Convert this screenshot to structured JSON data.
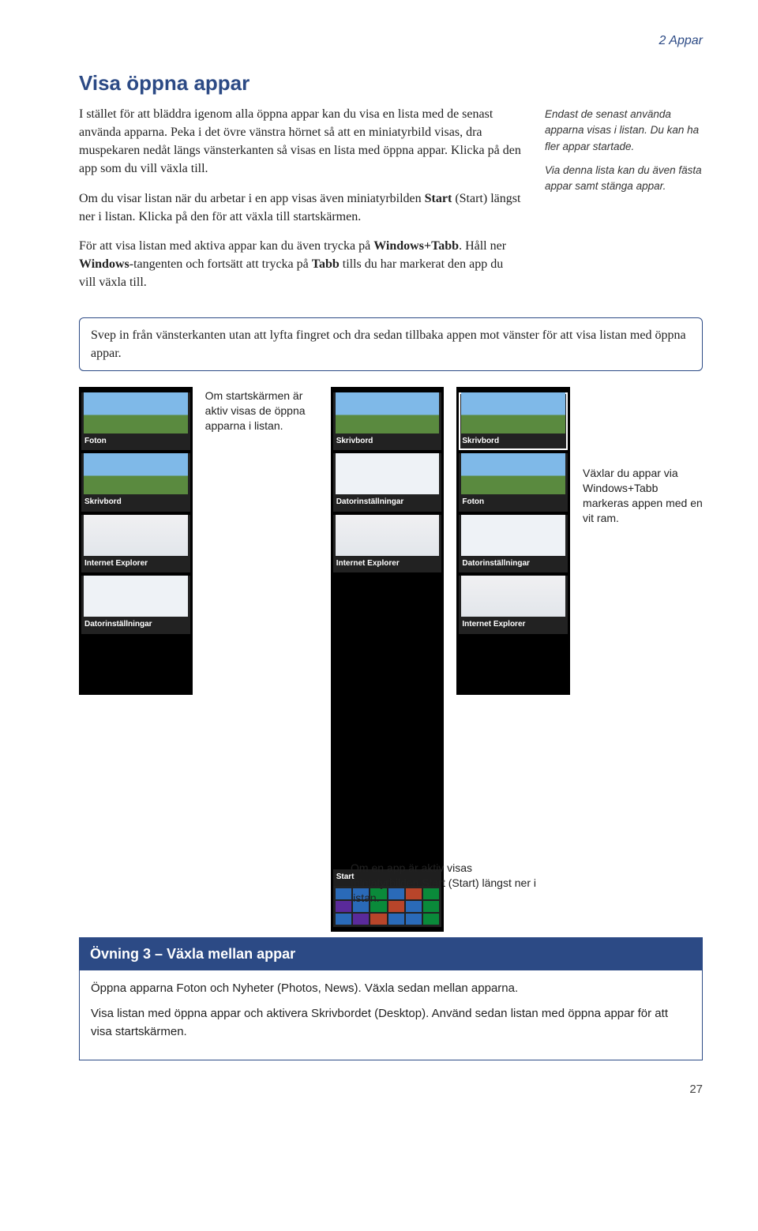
{
  "chapter_label": "2 Appar",
  "heading": "Visa öppna appar",
  "para1": "I stället för att bläddra igenom alla öppna appar kan du visa en lista med de senast använda apparna. Peka i det övre vänstra hörnet så att en miniatyrbild visas, dra muspekaren nedåt längs vänsterkanten så visas en lista med öppna appar. Klicka på den app som du vill växla till.",
  "para2_before": "Om du visar listan när du arbetar i en app visas även miniatyrbilden ",
  "para2_bold1": "Start",
  "para2_mid": " (Start) längst ner i listan. Klicka på den för att växla till startskärmen.",
  "para3_before": "För att visa listan med aktiva appar kan du även trycka på ",
  "para3_bold1": "Windows+Tabb",
  "para3_mid": ". Håll ner ",
  "para3_bold2": "Windows",
  "para3_mid2": "-tangenten och fortsätt att trycka på ",
  "para3_bold3": "Tabb",
  "para3_end": " tills du har markerat den app du vill växla till.",
  "sidenote1": "Endast de senast använda apparna visas i listan. Du kan ha fler appar startade.",
  "sidenote2": "Via denna lista kan du även fästa appar samt stänga appar.",
  "tipbox": "Svep in från vänsterkanten utan att lyfta fingret och dra sedan tillbaka appen mot vänster för att visa listan med öppna appar.",
  "caption_startskarm": "Om startskärmen är aktiv visas de öppna apparna i listan.",
  "caption_tab": "Växlar du appar via Windows+Tabb markeras appen med en vit ram.",
  "caption_start": "Om en app är aktiv visas miniatyrbilden Start (Start) längst ner i listan.",
  "strip1": {
    "items": [
      "Foton",
      "Skrivbord",
      "Internet Explorer",
      "Datorinställningar"
    ]
  },
  "strip2": {
    "items": [
      "Skrivbord",
      "Datorinställningar",
      "Internet Explorer"
    ],
    "start_label": "Start"
  },
  "strip3": {
    "items": [
      "Skrivbord",
      "Foton",
      "Datorinställningar",
      "Internet Explorer"
    ]
  },
  "exercise": {
    "head": "Övning 3 – Växla mellan appar",
    "p1": "Öppna apparna Foton och Nyheter (Photos, News). Växla sedan mellan apparna.",
    "p2": "Visa listan med öppna appar och aktivera Skrivbordet (Desktop). Använd sedan listan med öppna appar för att visa startskärmen."
  },
  "page_number": "27"
}
